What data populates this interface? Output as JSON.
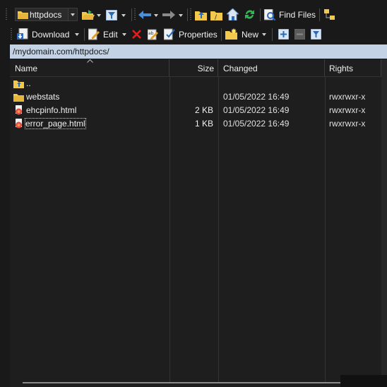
{
  "toolbar_top": {
    "location_combo": "httpdocs",
    "find_files_label": "Find Files"
  },
  "toolbar_files": {
    "download_label": "Download",
    "edit_label": "Edit",
    "properties_label": "Properties",
    "new_label": "New"
  },
  "address_path": "/mydomain.com/httpdocs/",
  "columns": {
    "name": "Name",
    "size": "Size",
    "changed": "Changed",
    "rights": "Rights"
  },
  "files": [
    {
      "name": "..",
      "size": "",
      "changed": "",
      "rights": "",
      "icon": "parent-folder-icon"
    },
    {
      "name": "webstats",
      "size": "",
      "changed": "01/05/2022 16:49",
      "rights": "rwxrwxr-x",
      "icon": "folder-icon"
    },
    {
      "name": "ehcpinfo.html",
      "size": "2 KB",
      "changed": "01/05/2022 16:49",
      "rights": "rwxrwxr-x",
      "icon": "html-file-icon"
    },
    {
      "name": "error_page.html",
      "size": "1 KB",
      "changed": "01/05/2022 16:49",
      "rights": "rwxrwxr-x",
      "icon": "html-file-icon"
    }
  ],
  "colors": {
    "background": "#191919",
    "address_bar": "#c3d2e4",
    "folder": "#f2c94c",
    "accent_blue": "#4a90d9",
    "accent_green": "#2db84d",
    "delete_red": "#e02020"
  }
}
